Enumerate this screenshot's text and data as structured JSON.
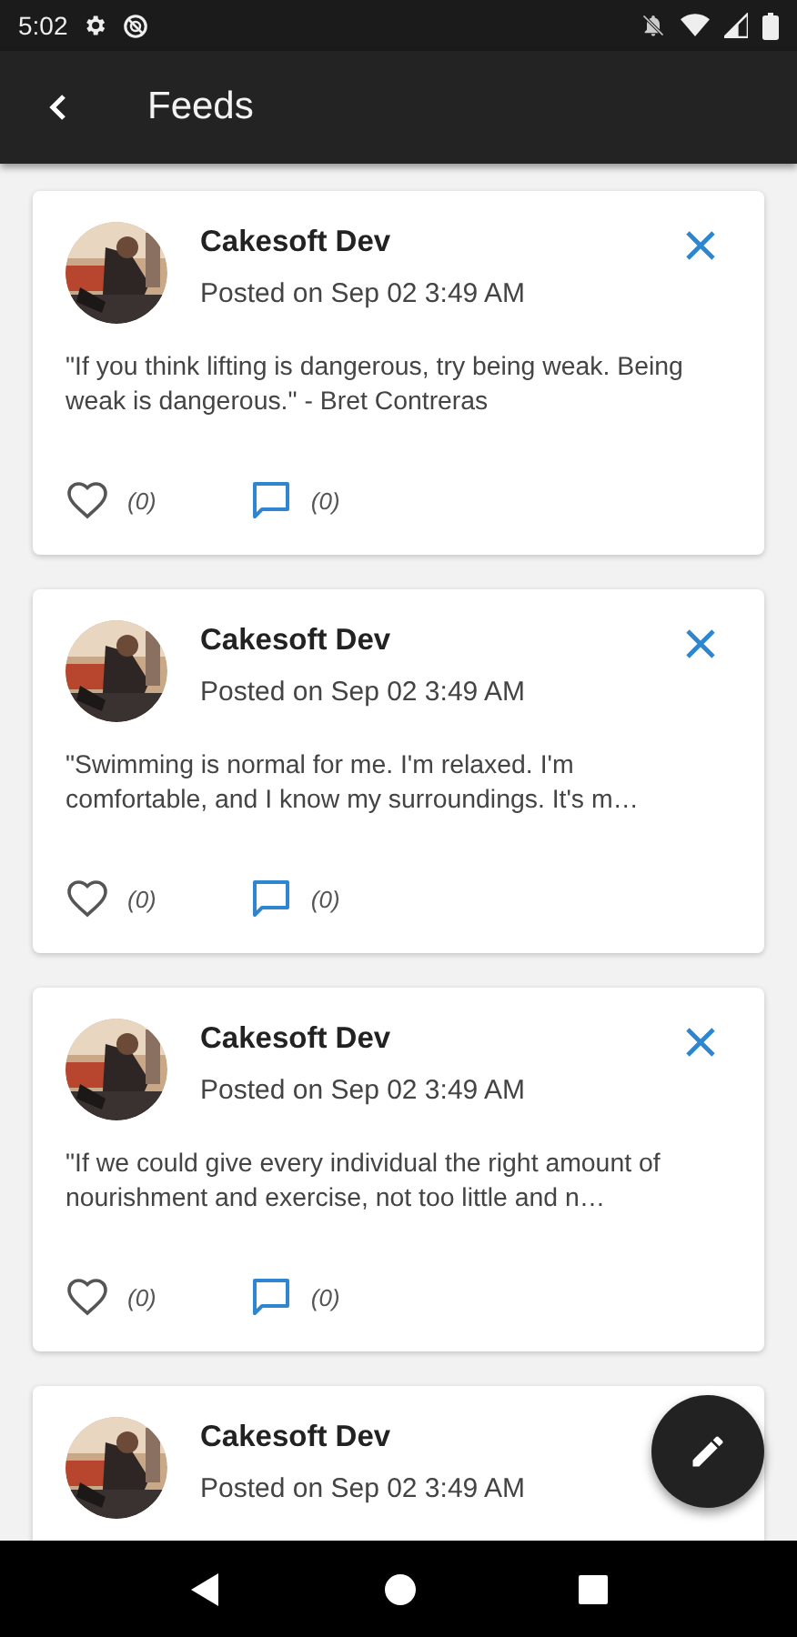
{
  "status_bar": {
    "time": "5:02"
  },
  "app_bar": {
    "title": "Feeds"
  },
  "posts": [
    {
      "author": "Cakesoft Dev",
      "posted": "Posted on Sep 02 3:49 AM",
      "closable": true,
      "body": "\"If you think lifting is dangerous, try being weak. Being weak is dangerous.\" - Bret Contreras",
      "likes": "(0)",
      "comments": "(0)"
    },
    {
      "author": "Cakesoft Dev",
      "posted": "Posted on Sep 02 3:49 AM",
      "closable": true,
      "body": "\"Swimming is normal for me. I'm relaxed. I'm comfortable, and I know my surroundings. It's m…",
      "likes": "(0)",
      "comments": "(0)"
    },
    {
      "author": "Cakesoft Dev",
      "posted": "Posted on Sep 02 3:49 AM",
      "closable": true,
      "body": "\"If we could give every individual the right amount of nourishment and exercise, not too little and n…",
      "likes": "(0)",
      "comments": "(0)"
    },
    {
      "author": "Cakesoft Dev",
      "posted": "Posted on Sep 02 3:49 AM",
      "closable": false
    }
  ]
}
